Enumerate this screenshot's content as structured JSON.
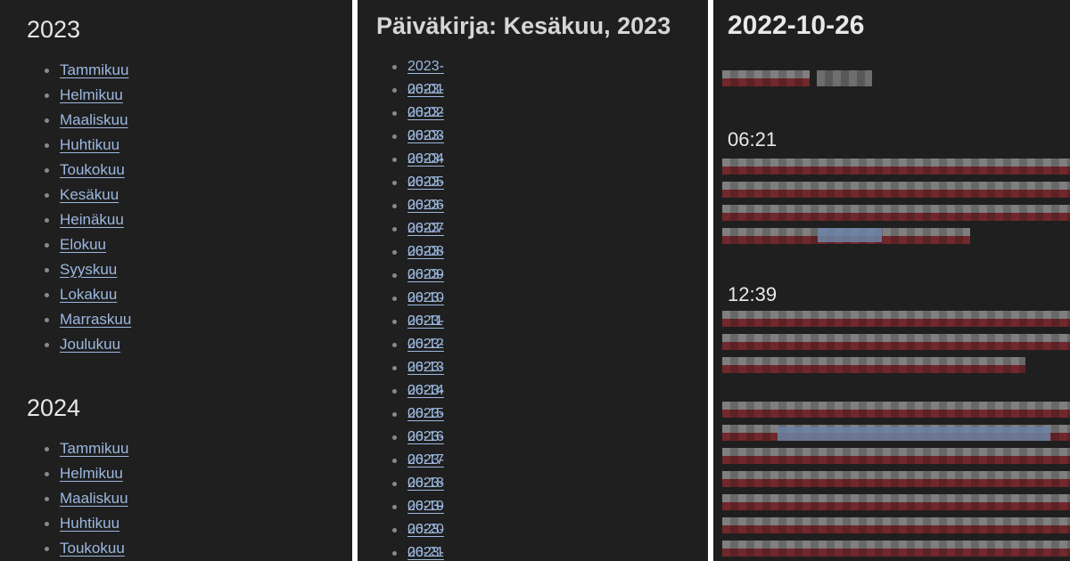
{
  "years_panel": {
    "sections": [
      {
        "year": "2023",
        "months": [
          "Tammikuu",
          "Helmikuu",
          "Maaliskuu",
          "Huhtikuu",
          "Toukokuu",
          "Kesäkuu",
          "Heinäkuu",
          "Elokuu",
          "Syyskuu",
          "Lokakuu",
          "Marraskuu",
          "Joulukuu"
        ]
      },
      {
        "year": "2024",
        "months": [
          "Tammikuu",
          "Helmikuu",
          "Maaliskuu",
          "Huhtikuu",
          "Toukokuu"
        ]
      }
    ]
  },
  "month_panel": {
    "title": "Päiväkirja: Kesäkuu, 2023",
    "days": [
      "2023-06-01",
      "2023-06-02",
      "2023-06-03",
      "2023-06-04",
      "2023-06-05",
      "2023-06-06",
      "2023-06-07",
      "2023-06-08",
      "2023-06-09",
      "2023-06-10",
      "2023-06-11",
      "2023-06-12",
      "2023-06-13",
      "2023-06-14",
      "2023-06-15",
      "2023-06-16",
      "2023-06-17",
      "2023-06-18",
      "2023-06-19",
      "2023-06-20",
      "2023-06-21",
      "2023-06-22"
    ]
  },
  "entry_panel": {
    "date": "2022-10-26",
    "times": [
      "06:21",
      "12:39"
    ]
  },
  "colors": {
    "panel_bg": "#1f1f1f",
    "divider": "#ffffff",
    "link": "#9cb8e0",
    "heading": "#e6e6e6",
    "redacted_red": "#7a2a2e",
    "redacted_gray": "#8a8a8a",
    "redacted_blue": "#6c84a6"
  }
}
